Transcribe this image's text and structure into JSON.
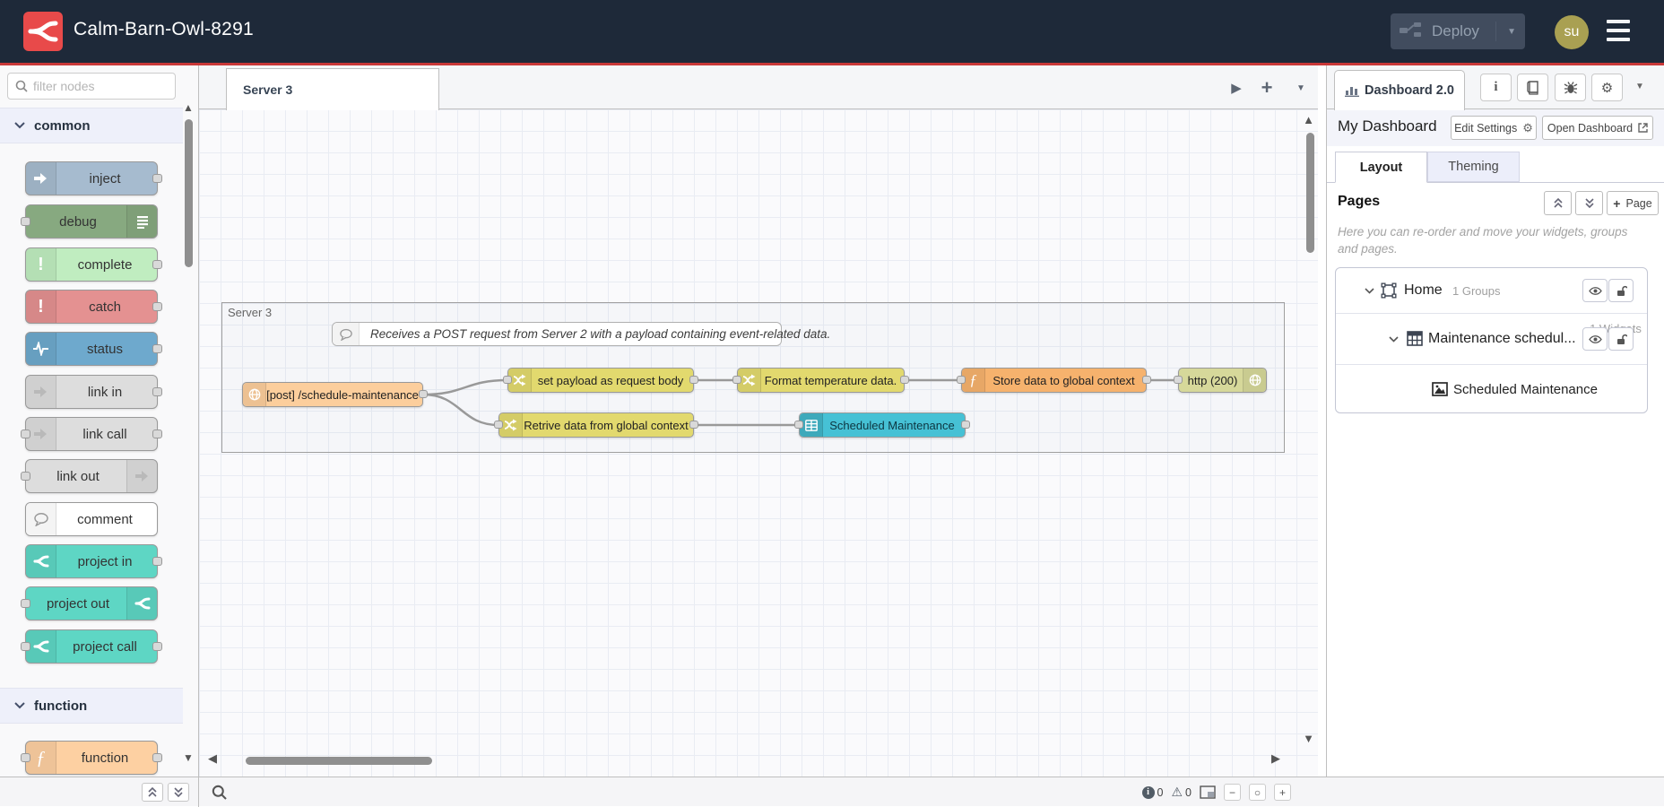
{
  "icons": {
    "play": "▶",
    "plus": "+",
    "caret_down": "▼",
    "triangle_up": "▲",
    "triangle_down": "▼",
    "triangle_left": "◀",
    "triangle_right": "▶",
    "gear": "⚙",
    "minus": "−",
    "circle_o": "○",
    "warning": "⚠",
    "info_letter": "i",
    "function_glyph": "ƒ",
    "exclamation": "!"
  },
  "header": {
    "title": "Calm-Barn-Owl-8291",
    "deploy_label": "Deploy",
    "avatar_initials": "su"
  },
  "tabbar": {
    "active_tab": "Server 3"
  },
  "palette": {
    "filter_placeholder": "filter nodes",
    "categories": [
      {
        "label": "common"
      },
      {
        "label": "function"
      }
    ],
    "nodes": [
      {
        "label": "inject",
        "color": "#a6bbcf"
      },
      {
        "label": "debug",
        "color": "#87a980"
      },
      {
        "label": "complete",
        "color": "#c0edc0"
      },
      {
        "label": "catch",
        "color": "#e49191"
      },
      {
        "label": "status",
        "color": "#6ea9cd"
      },
      {
        "label": "link in",
        "color": "#dddddd"
      },
      {
        "label": "link call",
        "color": "#dddddd"
      },
      {
        "label": "link out",
        "color": "#dddddd"
      },
      {
        "label": "comment",
        "color": "#ffffff"
      },
      {
        "label": "project in",
        "color": "#5ed6c4"
      },
      {
        "label": "project out",
        "color": "#5ed6c4"
      },
      {
        "label": "project call",
        "color": "#5ed6c4"
      },
      {
        "label": "function",
        "color": "#fdd0a2"
      }
    ]
  },
  "flow": {
    "group_label": "Server 3",
    "comment_text": "Receives a POST request from Server 2 with a payload containing event-related data.",
    "nodes": [
      {
        "label": "[post] /schedule-maintenance",
        "color": "#fcce9c"
      },
      {
        "label": "set payload as request body",
        "color": "#e2d96e"
      },
      {
        "label": "Format temperature data.",
        "color": "#e2d96e"
      },
      {
        "label": "Store data to global context",
        "color": "#f6b26d"
      },
      {
        "label": "http (200)",
        "color": "#d6d89a"
      },
      {
        "label": "Retrive data from global context",
        "color": "#e2d96e"
      },
      {
        "label": "Scheduled Maintenance",
        "color": "#46c1d5"
      }
    ]
  },
  "footer": {
    "error_count": "0",
    "warning_count": "0"
  },
  "sidebar": {
    "tab_label": "Dashboard 2.0",
    "dashboard_name": "My Dashboard",
    "edit_settings_label": "Edit Settings",
    "open_dashboard_label": "Open Dashboard",
    "layout_tab": "Layout",
    "theming_tab": "Theming",
    "pages_title": "Pages",
    "add_page_label": "Page",
    "description": "Here you can re-order and move your widgets, groups and pages.",
    "tree": {
      "page_name": "Home",
      "page_meta": "1 Groups",
      "group_name": "Maintenance schedul...",
      "group_meta": "1 Widgets",
      "widget_name": "Scheduled Maintenance"
    }
  }
}
